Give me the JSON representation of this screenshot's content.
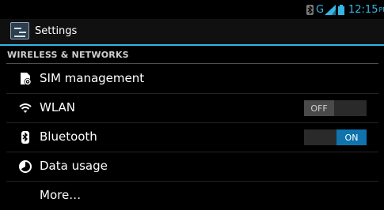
{
  "status_bar": {
    "bluetooth_icon": "bluetooth-icon",
    "network_type": "G",
    "signal_icon": "signal-icon",
    "battery_icon": "battery-icon",
    "time": "12:15",
    "ampm": "PM",
    "accent_color": "#33b5e5"
  },
  "action_bar": {
    "icon": "settings-app-icon",
    "title": "Settings"
  },
  "sections": {
    "wireless_networks": {
      "header": "WIRELESS & NETWORKS"
    }
  },
  "items": {
    "sim": {
      "icon": "sim-card-icon",
      "label": "SIM management"
    },
    "wlan": {
      "icon": "wifi-icon",
      "label": "WLAN",
      "toggle_label": "OFF",
      "state": "off"
    },
    "bluetooth": {
      "icon": "bluetooth-icon",
      "label": "Bluetooth",
      "toggle_label": "ON",
      "state": "on"
    },
    "data_usage": {
      "icon": "data-usage-icon",
      "label": "Data usage"
    },
    "more": {
      "label": "More…"
    }
  }
}
